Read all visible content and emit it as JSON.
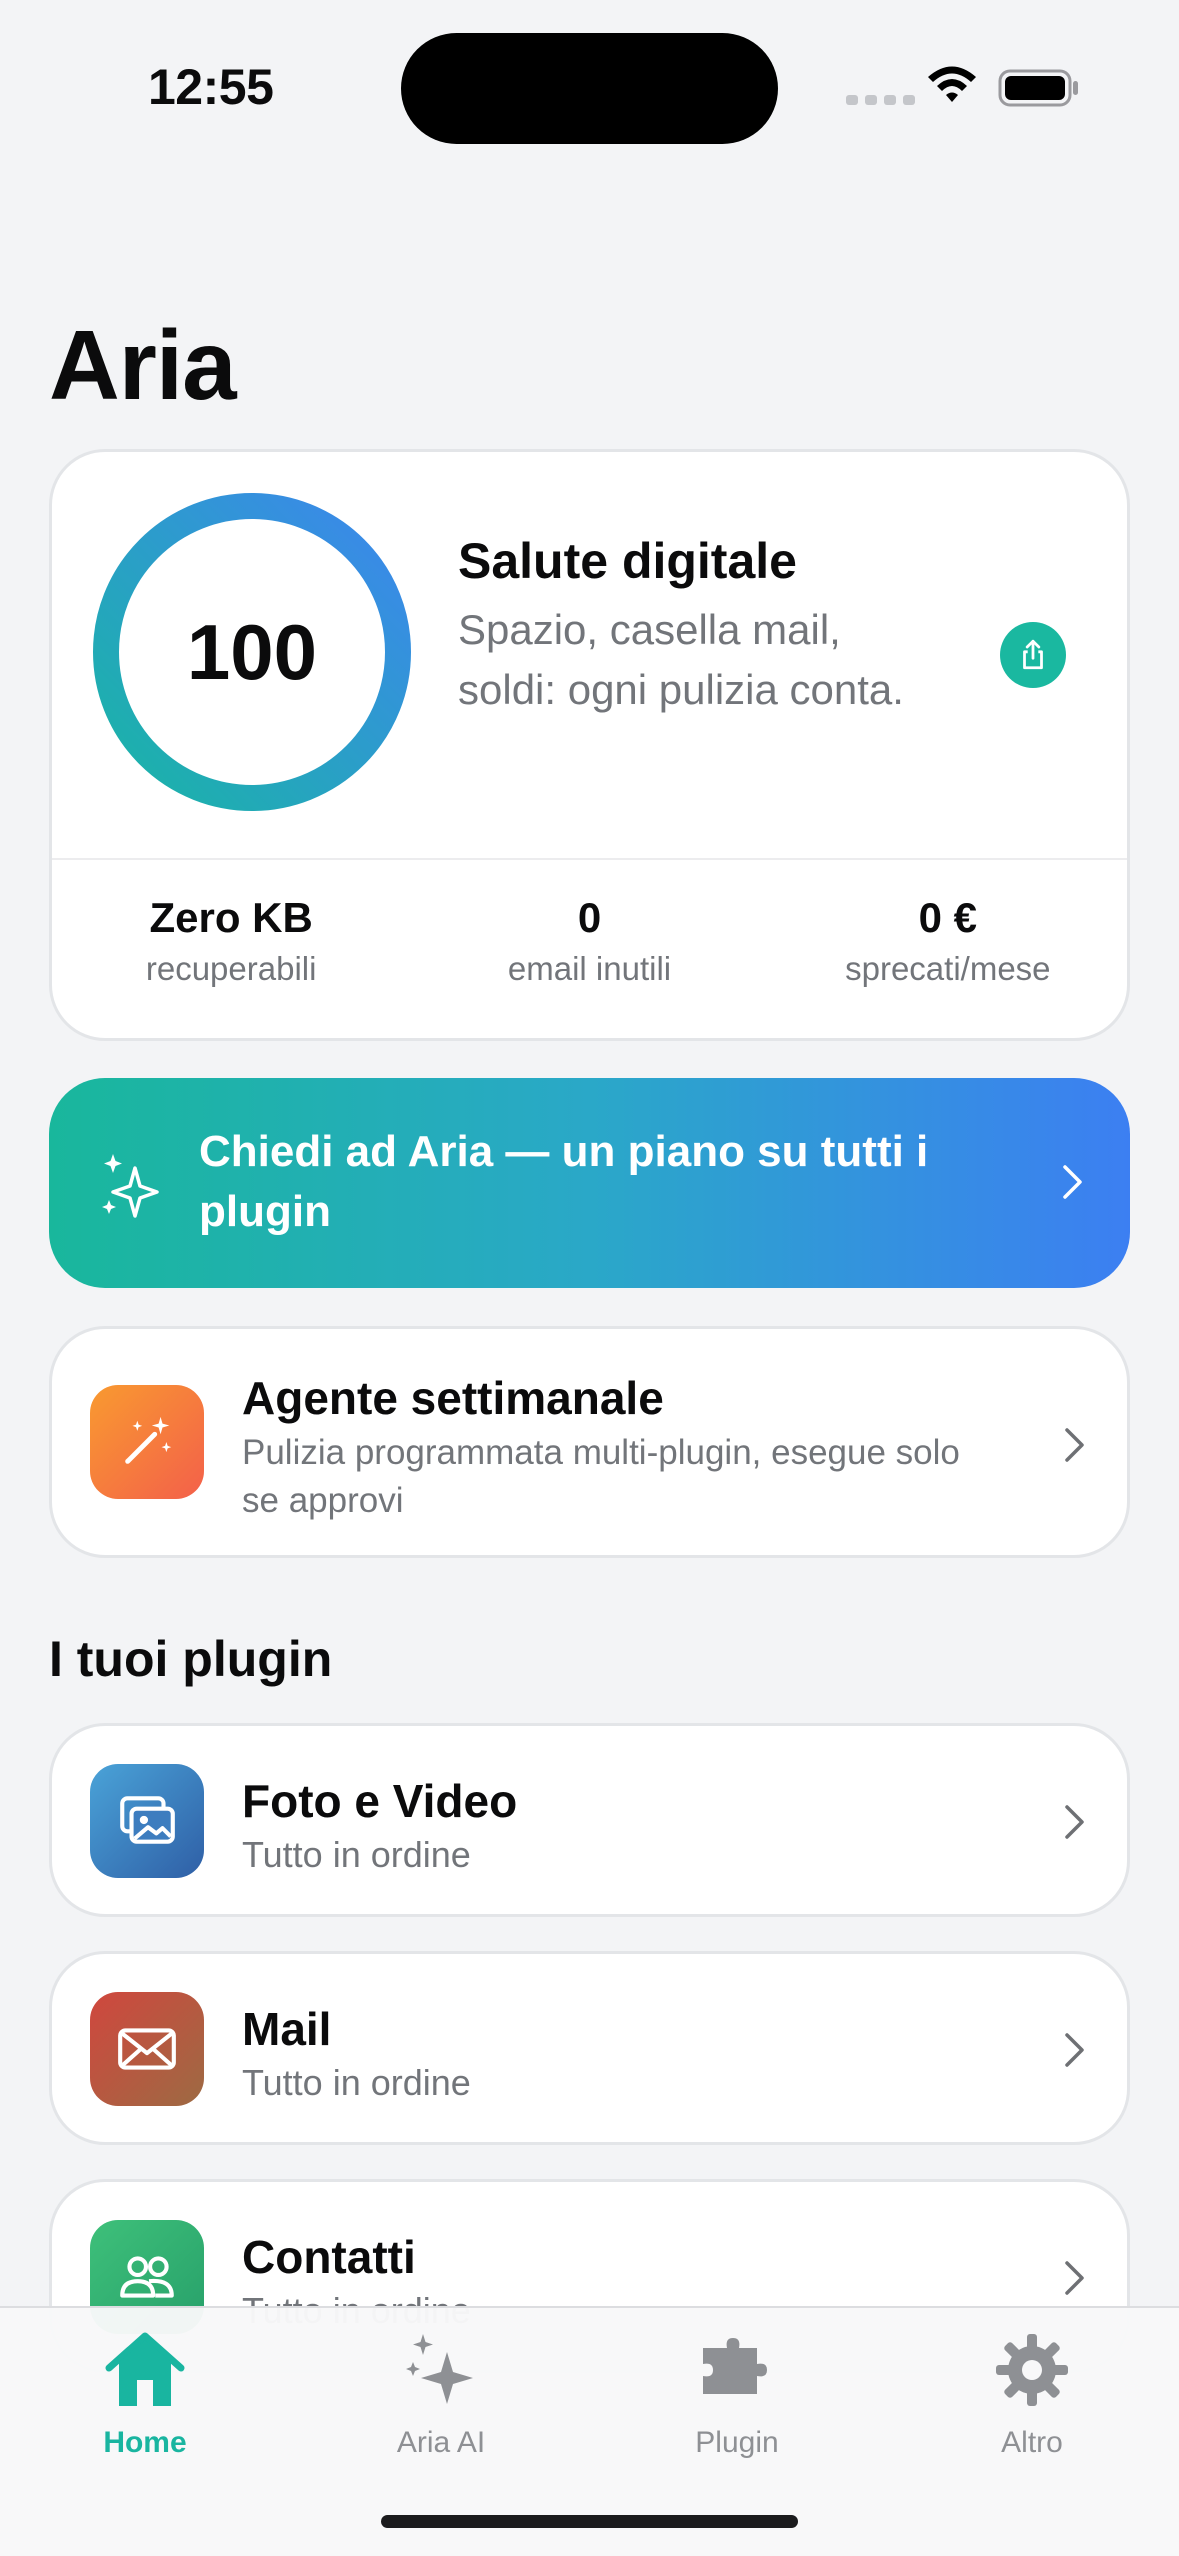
{
  "status_bar": {
    "time": "12:55"
  },
  "header": {
    "title": "Aria"
  },
  "health_card": {
    "score": "100",
    "title": "Salute digitale",
    "description": "Spazio, casella mail, soldi: ogni pulizia conta.",
    "stats": [
      {
        "value": "Zero KB",
        "label": "recuperabili"
      },
      {
        "value": "0",
        "label": "email inutili"
      },
      {
        "value": "0 €",
        "label": "sprecati/mese"
      }
    ]
  },
  "aria_banner": {
    "text": "Chiedi ad Aria — un piano su tutti i plugin"
  },
  "agent_card": {
    "title": "Agente settimanale",
    "description": "Pulizia programmata multi-plugin, esegue solo se approvi"
  },
  "plugins_section": {
    "title": "I tuoi plugin",
    "items": [
      {
        "name": "Foto e Video",
        "status": "Tutto in ordine",
        "icon": "photos-icon"
      },
      {
        "name": "Mail",
        "status": "Tutto in ordine",
        "icon": "envelope-icon"
      },
      {
        "name": "Contatti",
        "status": "Tutto in ordine",
        "icon": "people-icon"
      }
    ]
  },
  "tab_bar": {
    "tabs": [
      {
        "label": "Home",
        "icon": "house-icon",
        "active": true
      },
      {
        "label": "Aria AI",
        "icon": "sparkles-icon",
        "active": false
      },
      {
        "label": "Plugin",
        "icon": "puzzle-icon",
        "active": false
      },
      {
        "label": "Altro",
        "icon": "gear-icon",
        "active": false
      }
    ]
  },
  "colors": {
    "accent": "#19b5a0",
    "gradient_start": "#19b79c",
    "gradient_end": "#3c7ff2",
    "background": "#f3f4f6"
  }
}
